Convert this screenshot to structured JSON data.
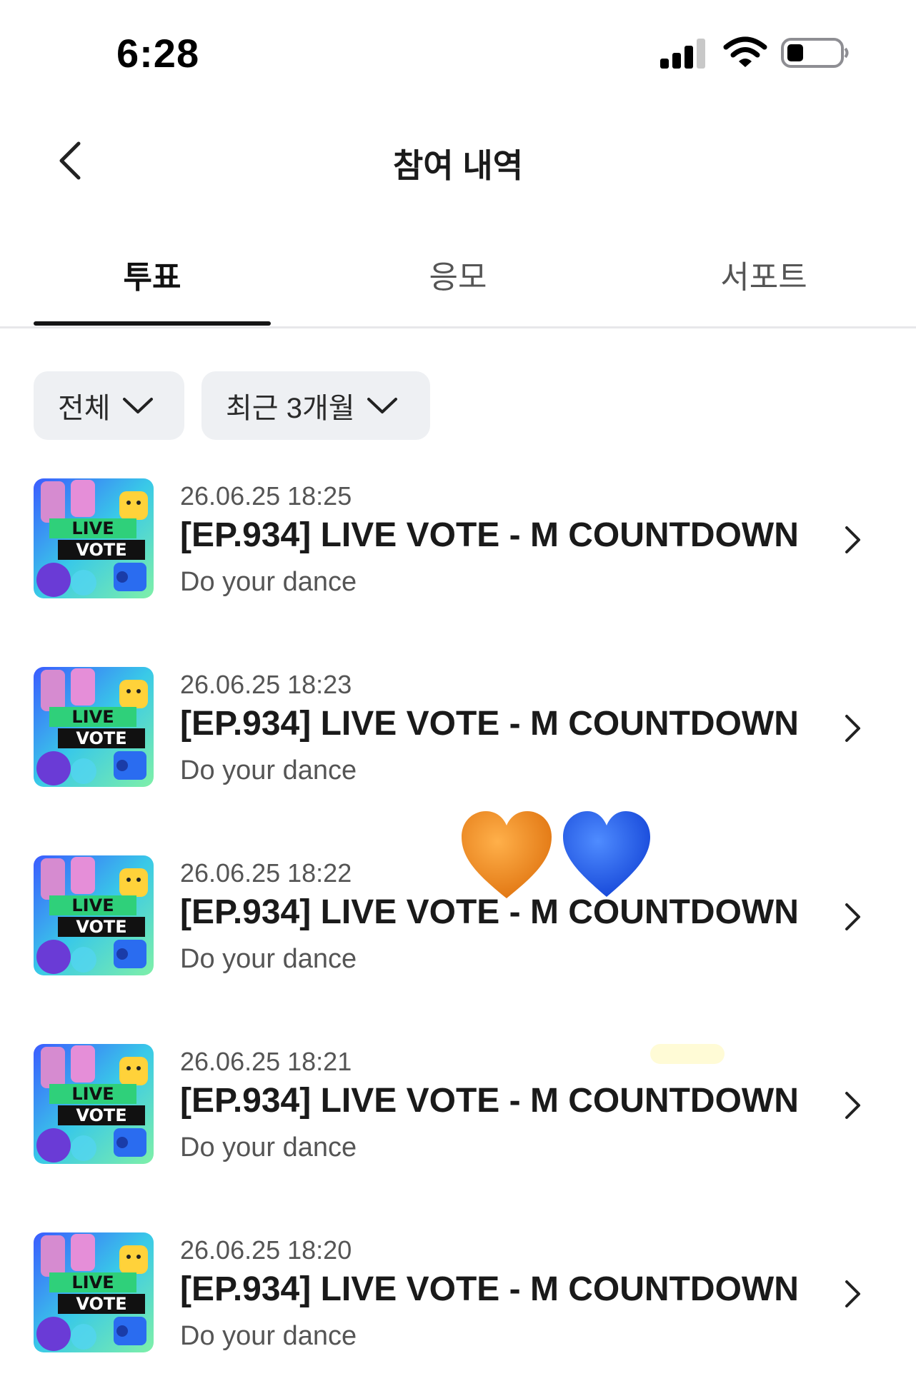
{
  "status_bar": {
    "time": "6:28"
  },
  "header": {
    "title": "참여 내역"
  },
  "tabs": [
    {
      "label": "투표",
      "active": true
    },
    {
      "label": "응모",
      "active": false
    },
    {
      "label": "서포트",
      "active": false
    }
  ],
  "filters": {
    "category": "전체",
    "period": "최근 3개월"
  },
  "thumbnail": {
    "line1": "LIVE",
    "line2": "VOTE"
  },
  "items": [
    {
      "date": "26.06.25 18:25",
      "title": "[EP.934] LIVE VOTE - M COUNTDOWN",
      "subtitle": "Do your dance"
    },
    {
      "date": "26.06.25 18:23",
      "title": "[EP.934] LIVE VOTE - M COUNTDOWN",
      "subtitle": "Do your dance"
    },
    {
      "date": "26.06.25 18:22",
      "title": "[EP.934] LIVE VOTE - M COUNTDOWN",
      "subtitle": "Do your dance"
    },
    {
      "date": "26.06.25 18:21",
      "title": "[EP.934] LIVE VOTE - M COUNTDOWN",
      "subtitle": "Do your dance"
    },
    {
      "date": "26.06.25 18:20",
      "title": "[EP.934] LIVE VOTE - M COUNTDOWN",
      "subtitle": "Do your dance"
    }
  ],
  "colors": {
    "orange_heart": "#f08a1c",
    "blue_heart": "#1e5bf0",
    "chip_bg": "#eef0f3"
  }
}
